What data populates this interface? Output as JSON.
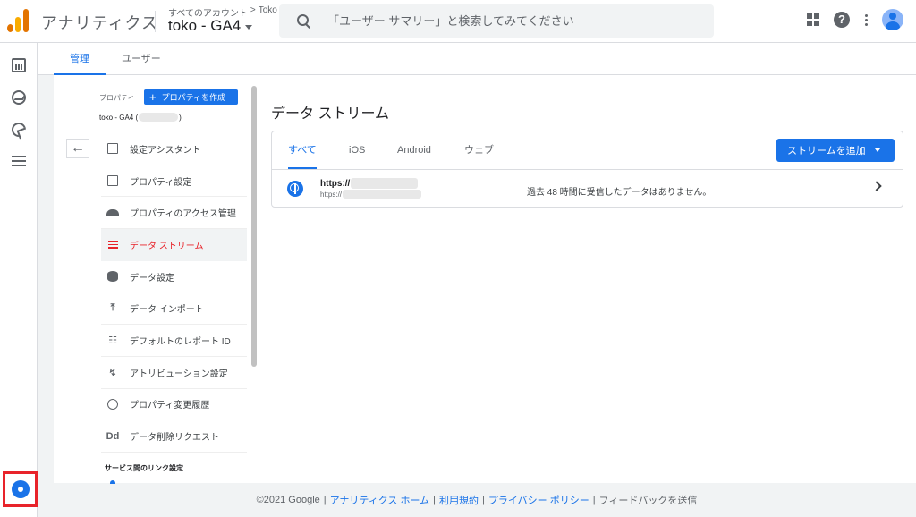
{
  "header": {
    "app_name": "アナリティクス",
    "breadcrumb_root": "すべてのアカウント",
    "breadcrumb_sep": ">",
    "breadcrumb_account": "Toko",
    "property": "toko - GA4",
    "search_placeholder": "「ユーザー サマリー」と検索してみてください"
  },
  "tabs": {
    "admin": "管理",
    "user": "ユーザー"
  },
  "property_nav": {
    "label": "プロパティ",
    "create_label": "プロパティを作成",
    "property_sub_prefix": "toko - GA4 (",
    "property_sub_suffix": ")",
    "items": [
      {
        "label": "設定アシスタント",
        "icon": "checkbox-icon"
      },
      {
        "label": "プロパティ設定",
        "icon": "window-icon"
      },
      {
        "label": "プロパティのアクセス管理",
        "icon": "people-icon"
      },
      {
        "label": "データ ストリーム",
        "icon": "streams-icon"
      },
      {
        "label": "データ設定",
        "icon": "database-icon"
      },
      {
        "label": "データ インポート",
        "icon": "upload-icon"
      },
      {
        "label": "デフォルトのレポート ID",
        "icon": "id-icon"
      },
      {
        "label": "アトリビューション設定",
        "icon": "attribution-icon"
      },
      {
        "label": "プロパティ変更履歴",
        "icon": "history-icon"
      },
      {
        "label": "データ削除リクエスト",
        "icon": "dd-icon"
      }
    ],
    "section_title": "サービス間のリンク設定"
  },
  "panel": {
    "title": "データ ストリーム",
    "tabs": [
      "すべて",
      "iOS",
      "Android",
      "ウェブ"
    ],
    "add_label": "ストリームを追加",
    "stream_url": "https://",
    "stream_url_small": "https://",
    "stream_message": "過去 48 時間に受信したデータはありません。"
  },
  "footer": {
    "copyright": "©2021 Google",
    "links": [
      "アナリティクス ホーム",
      "利用規約",
      "プライバシー ポリシー"
    ],
    "feedback": "フィードバックを送信"
  },
  "colors": {
    "accent": "#1a73e8",
    "active": "#e8232a",
    "highlight_box": "#e8232a"
  }
}
